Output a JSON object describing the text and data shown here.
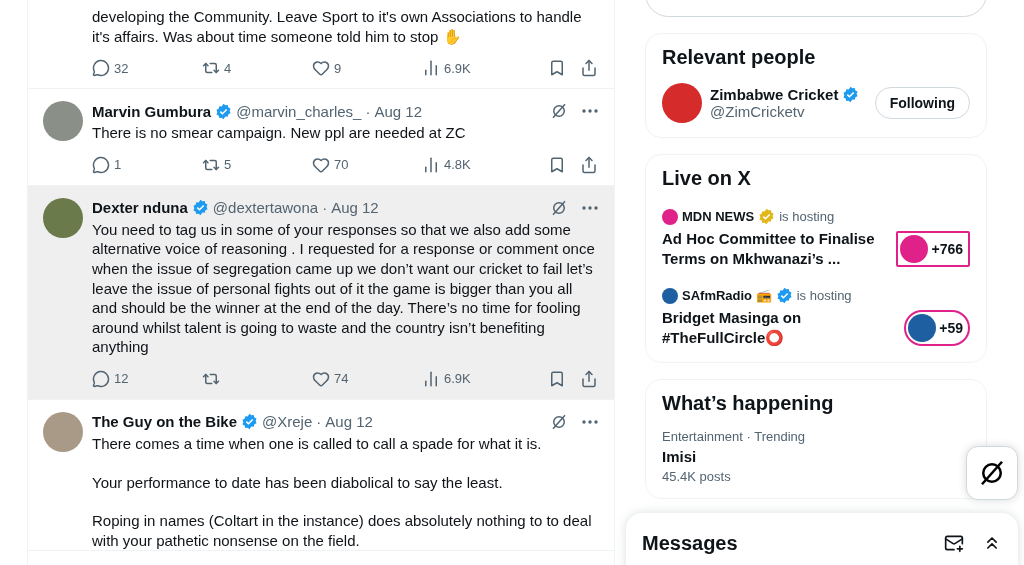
{
  "posts": [
    {
      "body": [
        "developing the Community. Leave Sport to it's own Associations to handle it's affairs. Was about time someone told him to stop ✋"
      ],
      "replies": "32",
      "reposts": "4",
      "likes": "9",
      "views": "6.9K",
      "highlighted": false
    },
    {
      "name": "Marvin Gumbura",
      "verified": true,
      "handle": "@marvin_charles_",
      "dot": "·",
      "date": "Aug 12",
      "body": [
        "There is no smear campaign. New ppl are needed at ZC"
      ],
      "replies": "1",
      "reposts": "5",
      "likes": "70",
      "views": "4.8K",
      "highlighted": false
    },
    {
      "name": "Dexter nduna",
      "verified": true,
      "handle": "@dextertawona",
      "dot": "·",
      "date": "Aug 12",
      "body": [
        "You need to tag us in some of your responses so that we also add some alternative voice of reasoning . I requested for a response or comment once when the issue of segregation came up we don’t want our cricket to fail let’s leave the issue of personal fights out of it the game is bigger than you all and should be the winner at the end of the day. There’s no time for fooling around whilst talent is going to waste and the country isn’t benefiting anything"
      ],
      "replies": "12",
      "likes": "74",
      "views": "6.9K",
      "highlighted": true
    },
    {
      "name": "The Guy on the Bike",
      "verified": true,
      "handle": "@Xreje",
      "dot": "·",
      "date": "Aug 12",
      "body": [
        "There comes a time when one is called to call a spade for what it is.",
        "Your performance to date has been diabolical to say the least.",
        "Roping in names (Coltart in the instance) does absolutely nothing to to deal with your pathetic nonsense on the field."
      ],
      "highlighted": false
    }
  ],
  "relevant_people": {
    "title": "Relevant people",
    "people": [
      {
        "name": "Zimbabwe Cricket",
        "handle": "@ZimCricketv",
        "verified": true,
        "button": "Following"
      }
    ]
  },
  "live": {
    "title": "Live on X",
    "items": [
      {
        "host": "MDN NEWS",
        "kind": "business",
        "color": "#e0218a",
        "status": "is hosting",
        "title": "Ad Hoc Committee to Finalise Terms on Mkhwanazi’s ...",
        "count": "+766"
      },
      {
        "host": "SAfmRadio 📻",
        "kind": "standard",
        "color": "#1d5fa0",
        "status": "is hosting",
        "title": "Bridget Masinga on #TheFullCircle⭕",
        "count": "+59"
      }
    ]
  },
  "happening": {
    "title": "What’s happening",
    "trends": [
      {
        "meta": "Entertainment · Trending",
        "name": "Imisi",
        "posts": "45.4K posts"
      }
    ]
  },
  "messages": {
    "title": "Messages"
  }
}
